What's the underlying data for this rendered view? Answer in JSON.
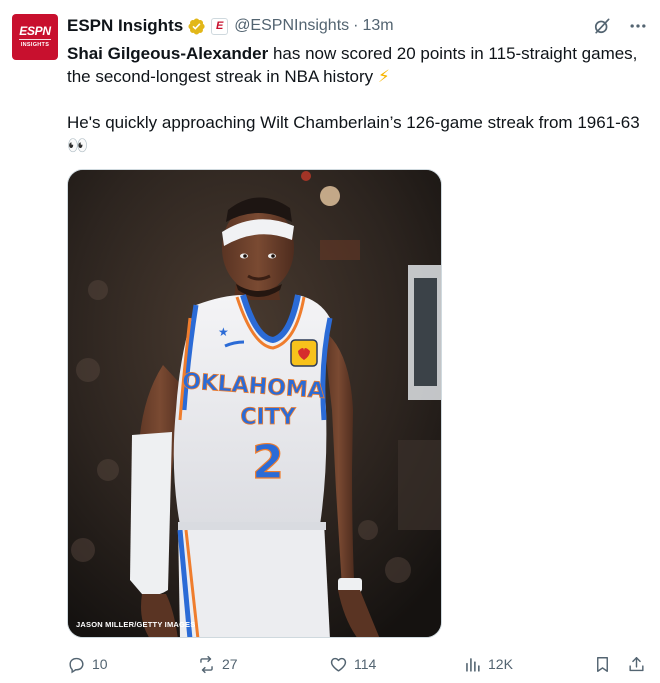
{
  "author": {
    "avatar": {
      "brand": "ESPN",
      "sub": "INSIGHTS",
      "color": "#c8102e"
    },
    "name": "ESPN Insights",
    "verified_icon": "gold-verified-badge-icon",
    "affiliate_badge": "E",
    "handle": "@ESPNInsights",
    "separator": "·",
    "time": "13m"
  },
  "top_actions": [
    "grok-icon",
    "more-icon"
  ],
  "text": {
    "line1_bold": "Shai Gilgeous-Alexander",
    "line1_rest": " has now scored 20 points in 115-straight games, the second-longest streak in NBA history ",
    "line1_emoji": "⚡",
    "line2": "He's quickly approaching Wilt Chamberlain’s 126-game streak from 1961-63 ",
    "line2_emoji": "👀"
  },
  "media": {
    "credit": "JASON MILLER/GETTY IMAGES",
    "jersey": {
      "team_line1": "OKLAHOMA",
      "team_line2": "CITY",
      "number": "2"
    }
  },
  "actions": {
    "replies": "10",
    "reposts": "27",
    "likes": "114",
    "views": "12K"
  },
  "colors": {
    "secondary_text": "#536471",
    "jersey_blue": "#2b6bd6",
    "jersey_orange": "#ef7d2d"
  }
}
